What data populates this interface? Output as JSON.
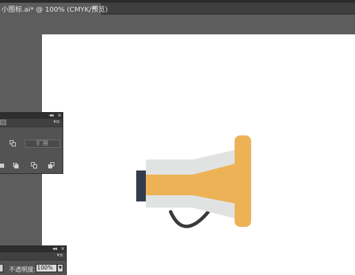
{
  "document_tab": {
    "title": "小图标.ai* @ 100% (CMYK/预览)",
    "close_glyph": "×"
  },
  "panel_1": {
    "collapse_glyph": "◂◂",
    "close_glyph": "×",
    "menu_glyph": "▾≡",
    "expand_label": "扩展"
  },
  "panel_2": {
    "collapse_glyph": "◂◂",
    "close_glyph": "×",
    "menu_glyph": "▾≡",
    "opacity_label": "不透明度:",
    "opacity_value": "100%",
    "dropdown_glyph": "▼"
  },
  "colors": {
    "workspace": "#5d5d5d",
    "artboard": "#ffffff",
    "megaphone_body": "#e1e3e3",
    "megaphone_accent": "#edb256",
    "megaphone_cap": "#323c4e",
    "megaphone_handle": "#3a3a3a"
  }
}
